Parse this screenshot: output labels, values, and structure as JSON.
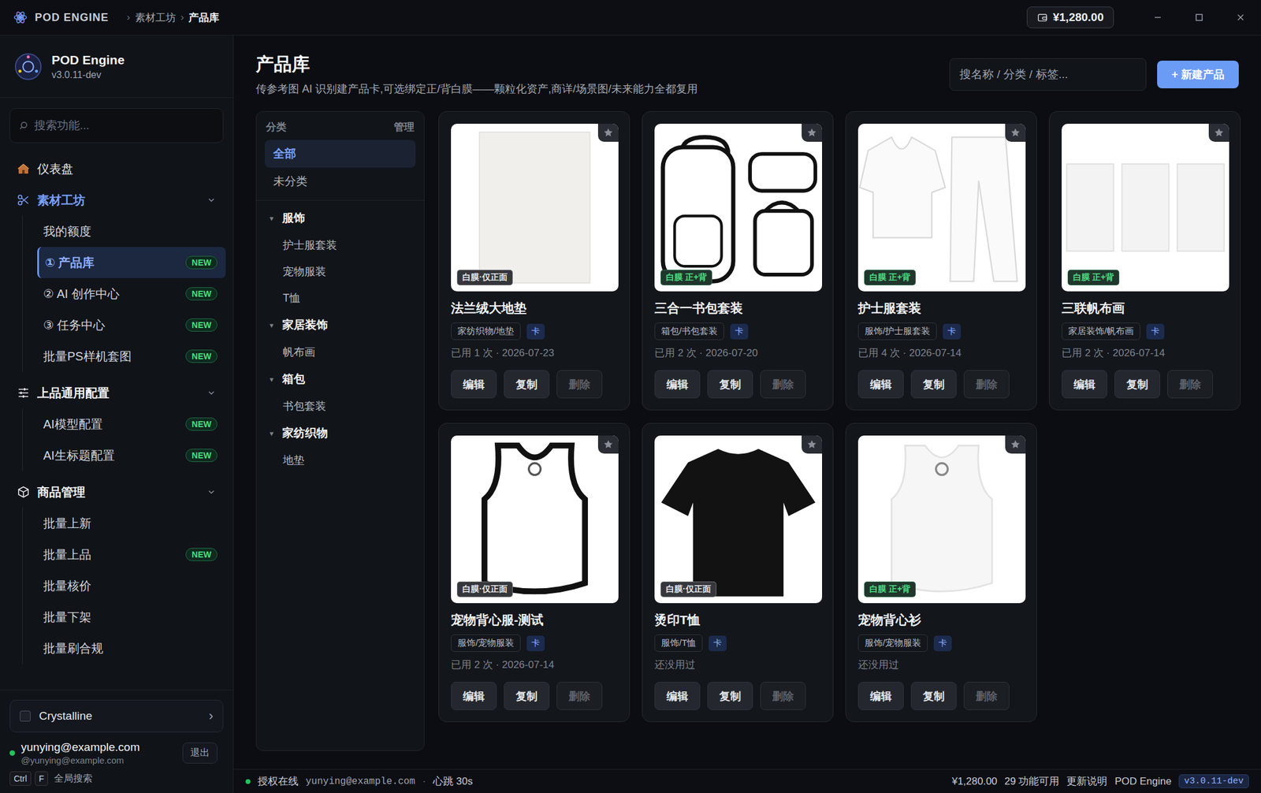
{
  "topbar": {
    "app_name": "POD ENGINE",
    "breadcrumb": [
      {
        "label": "素材工坊",
        "current": false
      },
      {
        "label": "产品库",
        "current": true
      }
    ],
    "separator": "›",
    "balance": "¥1,280.00"
  },
  "sidebar": {
    "brand": "POD Engine",
    "version": "v3.0.11-dev",
    "search_placeholder": "搜索功能...",
    "sections": [
      {
        "label": "仪表盘",
        "kind": "link",
        "active": false,
        "expanded": false,
        "items": []
      },
      {
        "label": "素材工坊",
        "kind": "group",
        "active": true,
        "expanded": true,
        "items": [
          {
            "label": "我的额度",
            "selected": false
          },
          {
            "label": "① 产品库",
            "badge": "NEW",
            "selected": true
          },
          {
            "label": "② AI 创作中心",
            "badge": "NEW",
            "selected": false
          },
          {
            "label": "③ 任务中心",
            "badge": "NEW",
            "selected": false
          },
          {
            "label": "批量PS样机套图",
            "badge": "NEW",
            "selected": false
          }
        ]
      },
      {
        "label": "上品通用配置",
        "kind": "group",
        "active": false,
        "expanded": true,
        "items": [
          {
            "label": "AI模型配置",
            "badge": "NEW",
            "selected": false
          },
          {
            "label": "AI生标题配置",
            "badge": "NEW",
            "selected": false
          }
        ]
      },
      {
        "label": "商品管理",
        "kind": "group",
        "active": false,
        "expanded": true,
        "items": [
          {
            "label": "批量上新",
            "selected": false
          },
          {
            "label": "批量上品",
            "badge": "NEW",
            "selected": false
          },
          {
            "label": "批量核价",
            "selected": false
          },
          {
            "label": "批量下架",
            "selected": false
          },
          {
            "label": "批量刷合规",
            "selected": false
          }
        ]
      }
    ],
    "workspace": {
      "name": "Crystalline",
      "chevron": "›"
    },
    "user": {
      "email": "yunying@example.com",
      "handle": "@yunying@example.com",
      "online": true,
      "logout": "退出"
    },
    "shortcut": {
      "keys": [
        "Ctrl",
        "F"
      ],
      "label": "全局搜索"
    }
  },
  "page": {
    "title": "产品库",
    "subtitle": "传参考图 AI 识别建产品卡,可选绑定正/背白膜——颗粒化资产,商详/场景图/未来能力全都复用",
    "search_placeholder": "搜名称 / 分类 / 标签...",
    "new_button": "+ 新建产品"
  },
  "categories": {
    "title": "分类",
    "manage": "管理",
    "top": [
      {
        "label": "全部",
        "selected": true
      },
      {
        "label": "未分类",
        "selected": false
      }
    ],
    "groups": [
      {
        "label": "服饰",
        "caret": "▾",
        "expanded": true,
        "items": [
          {
            "label": "护士服套装",
            "selected": false
          },
          {
            "label": "宠物服装",
            "selected": false
          },
          {
            "label": "T恤",
            "selected": false
          }
        ]
      },
      {
        "label": "家居装饰",
        "caret": "▾",
        "expanded": true,
        "items": [
          {
            "label": "帆布画",
            "selected": false
          }
        ]
      },
      {
        "label": "箱包",
        "caret": "▾",
        "expanded": true,
        "items": [
          {
            "label": "书包套装",
            "selected": false
          }
        ]
      },
      {
        "label": "家纺织物",
        "caret": "▾",
        "expanded": true,
        "items": [
          {
            "label": "地垫",
            "selected": false
          }
        ]
      }
    ]
  },
  "card_actions": [
    {
      "label": "编辑",
      "disabled": false
    },
    {
      "label": "复制",
      "disabled": false
    },
    {
      "label": "删除",
      "disabled": true
    }
  ],
  "products": [
    {
      "name": "法兰绒大地垫",
      "badge": {
        "text": "白膜·仅正面",
        "color": "#e5e7eb"
      },
      "category": "家纺织物/地垫",
      "chip": "卡",
      "usage": "已用 1 次 · 2026-07-23",
      "starred": false,
      "photo": "rug"
    },
    {
      "name": "三合一书包套装",
      "badge": {
        "text": "白膜 正+背",
        "color": "#4ade80"
      },
      "category": "箱包/书包套装",
      "chip": "卡",
      "usage": "已用 2 次 · 2026-07-20",
      "starred": false,
      "photo": "bags"
    },
    {
      "name": "护士服套装",
      "badge": {
        "text": "白膜 正+背",
        "color": "#4ade80"
      },
      "category": "服饰/护士服套装",
      "chip": "卡",
      "usage": "已用 4 次 · 2026-07-14",
      "starred": false,
      "photo": "scrubs"
    },
    {
      "name": "三联帆布画",
      "badge": {
        "text": "白膜 正+背",
        "color": "#4ade80"
      },
      "category": "家居装饰/帆布画",
      "chip": "卡",
      "usage": "已用 2 次 · 2026-07-14",
      "starred": false,
      "photo": "triptych"
    },
    {
      "name": "宠物背心服-测试",
      "badge": {
        "text": "白膜·仅正面",
        "color": "#e5e7eb"
      },
      "category": "服饰/宠物服装",
      "chip": "卡",
      "usage": "已用 2 次 · 2026-07-14",
      "starred": false,
      "photo": "vest-trim"
    },
    {
      "name": "烫印T恤",
      "badge": {
        "text": "白膜·仅正面",
        "color": "#e5e7eb"
      },
      "category": "服饰/T恤",
      "chip": "卡",
      "usage": "还没用过",
      "starred": false,
      "photo": "tee-black"
    },
    {
      "name": "宠物背心衫",
      "badge": {
        "text": "白膜 正+背",
        "color": "#4ade80"
      },
      "category": "服饰/宠物服装",
      "chip": "卡",
      "usage": "还没用过",
      "starred": false,
      "photo": "vest-white"
    }
  ],
  "status_bar": {
    "online": true,
    "auth": "授权在线",
    "user": "yunying@example.com",
    "separator": "·",
    "heartbeat": "心跳 30s",
    "balance": "¥1,280.00",
    "features": "29 功能可用",
    "changelog": "更新说明",
    "app": "POD Engine",
    "version": "v3.0.11-dev"
  }
}
